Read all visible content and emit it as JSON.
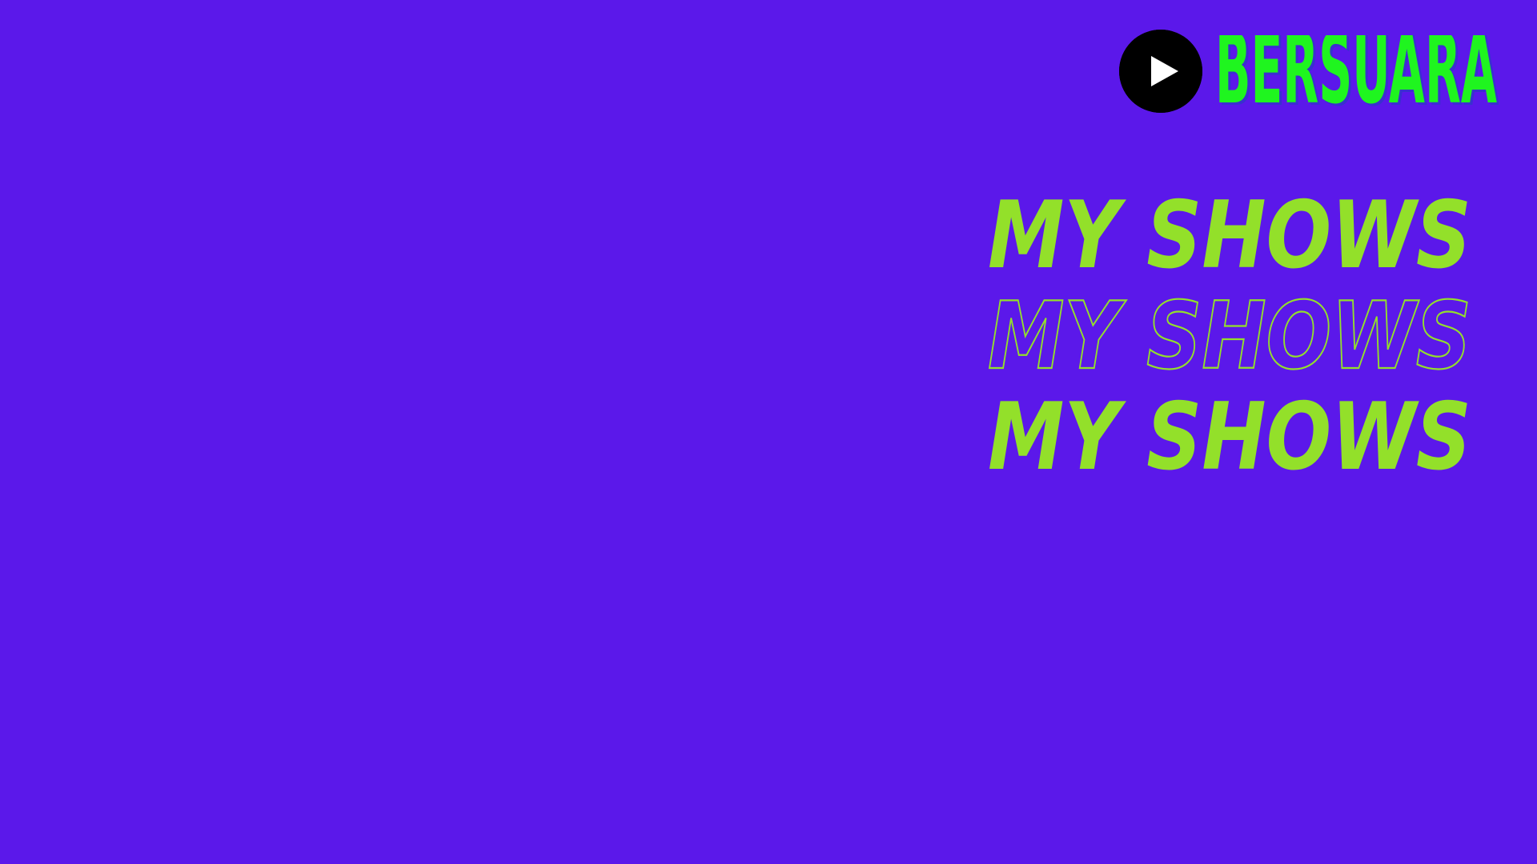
{
  "logo": {
    "icon": "play-icon",
    "brand_text": "BERSUARA",
    "brand_color": "#1ff51f",
    "brand_shadow": "#3a2fd0",
    "icon_background": "#000000",
    "icon_glyph_color": "#ffffff"
  },
  "titles": [
    {
      "text": "MY SHOWS",
      "style": "filled"
    },
    {
      "text": "MY SHOWS",
      "style": "outline"
    },
    {
      "text": "MY SHOWS",
      "style": "filled"
    }
  ],
  "colors": {
    "background": "#5b18ea",
    "title_accent": "#93e02a"
  }
}
